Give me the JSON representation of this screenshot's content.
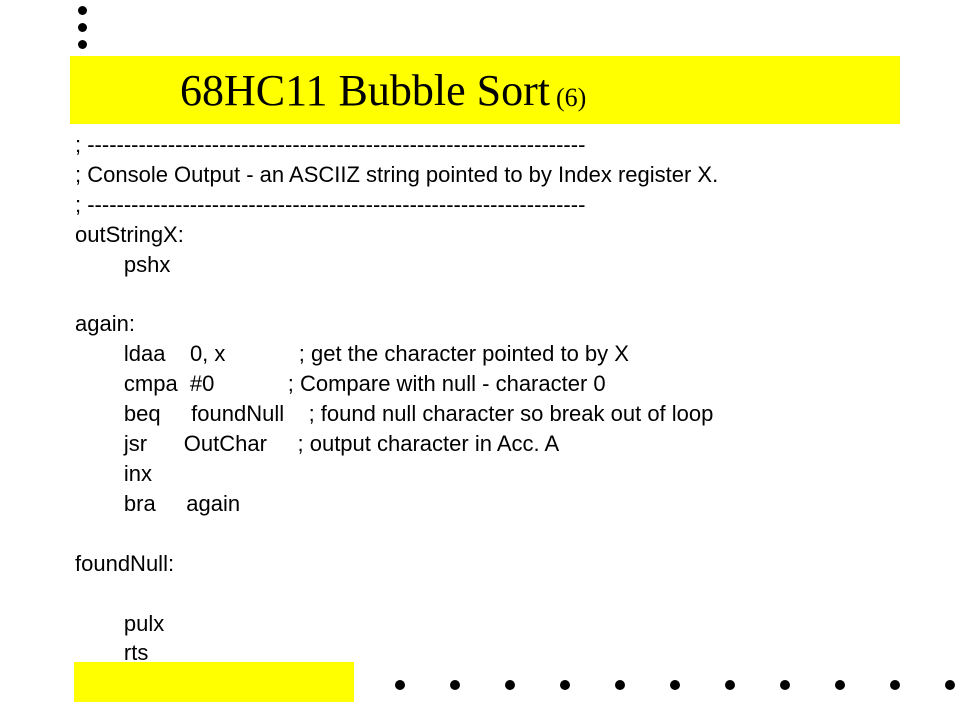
{
  "title": {
    "main": "68HC11 Bubble Sort ",
    "sub": "(6)"
  },
  "code": "; --------------------------------------------------------------------\n; Console Output - an ASCIIZ string pointed to by Index register X.\n; --------------------------------------------------------------------\noutStringX:\n        pshx\n\nagain:\n        ldaa    0, x            ; get the character pointed to by X\n        cmpa  #0            ; Compare with null - character 0\n        beq     foundNull    ; found null character so break out of loop\n        jsr      OutChar     ; output character in Acc. A\n        inx\n        bra     again\n\nfoundNull:\n\n        pulx\n        rts"
}
